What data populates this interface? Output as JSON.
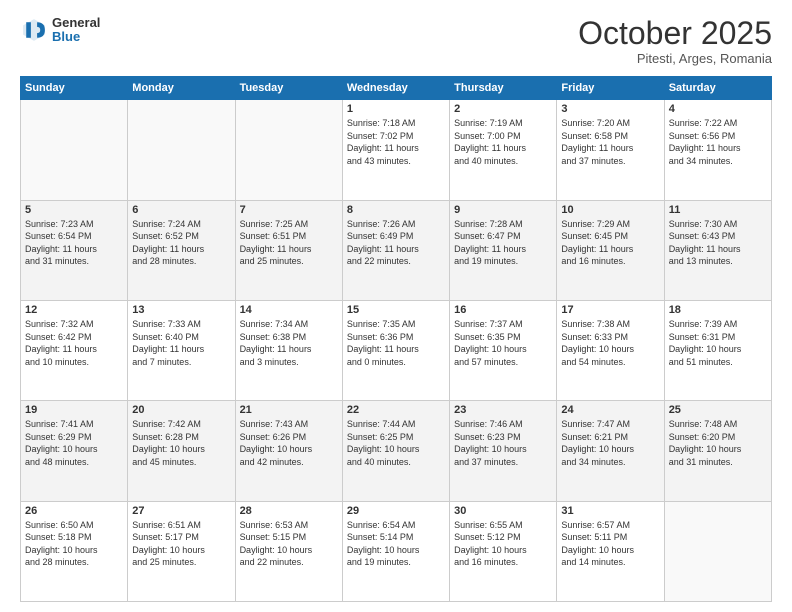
{
  "header": {
    "logo_general": "General",
    "logo_blue": "Blue",
    "month": "October 2025",
    "location": "Pitesti, Arges, Romania"
  },
  "days_of_week": [
    "Sunday",
    "Monday",
    "Tuesday",
    "Wednesday",
    "Thursday",
    "Friday",
    "Saturday"
  ],
  "weeks": [
    [
      {
        "day": "",
        "info": ""
      },
      {
        "day": "",
        "info": ""
      },
      {
        "day": "",
        "info": ""
      },
      {
        "day": "1",
        "info": "Sunrise: 7:18 AM\nSunset: 7:02 PM\nDaylight: 11 hours\nand 43 minutes."
      },
      {
        "day": "2",
        "info": "Sunrise: 7:19 AM\nSunset: 7:00 PM\nDaylight: 11 hours\nand 40 minutes."
      },
      {
        "day": "3",
        "info": "Sunrise: 7:20 AM\nSunset: 6:58 PM\nDaylight: 11 hours\nand 37 minutes."
      },
      {
        "day": "4",
        "info": "Sunrise: 7:22 AM\nSunset: 6:56 PM\nDaylight: 11 hours\nand 34 minutes."
      }
    ],
    [
      {
        "day": "5",
        "info": "Sunrise: 7:23 AM\nSunset: 6:54 PM\nDaylight: 11 hours\nand 31 minutes."
      },
      {
        "day": "6",
        "info": "Sunrise: 7:24 AM\nSunset: 6:52 PM\nDaylight: 11 hours\nand 28 minutes."
      },
      {
        "day": "7",
        "info": "Sunrise: 7:25 AM\nSunset: 6:51 PM\nDaylight: 11 hours\nand 25 minutes."
      },
      {
        "day": "8",
        "info": "Sunrise: 7:26 AM\nSunset: 6:49 PM\nDaylight: 11 hours\nand 22 minutes."
      },
      {
        "day": "9",
        "info": "Sunrise: 7:28 AM\nSunset: 6:47 PM\nDaylight: 11 hours\nand 19 minutes."
      },
      {
        "day": "10",
        "info": "Sunrise: 7:29 AM\nSunset: 6:45 PM\nDaylight: 11 hours\nand 16 minutes."
      },
      {
        "day": "11",
        "info": "Sunrise: 7:30 AM\nSunset: 6:43 PM\nDaylight: 11 hours\nand 13 minutes."
      }
    ],
    [
      {
        "day": "12",
        "info": "Sunrise: 7:32 AM\nSunset: 6:42 PM\nDaylight: 11 hours\nand 10 minutes."
      },
      {
        "day": "13",
        "info": "Sunrise: 7:33 AM\nSunset: 6:40 PM\nDaylight: 11 hours\nand 7 minutes."
      },
      {
        "day": "14",
        "info": "Sunrise: 7:34 AM\nSunset: 6:38 PM\nDaylight: 11 hours\nand 3 minutes."
      },
      {
        "day": "15",
        "info": "Sunrise: 7:35 AM\nSunset: 6:36 PM\nDaylight: 11 hours\nand 0 minutes."
      },
      {
        "day": "16",
        "info": "Sunrise: 7:37 AM\nSunset: 6:35 PM\nDaylight: 10 hours\nand 57 minutes."
      },
      {
        "day": "17",
        "info": "Sunrise: 7:38 AM\nSunset: 6:33 PM\nDaylight: 10 hours\nand 54 minutes."
      },
      {
        "day": "18",
        "info": "Sunrise: 7:39 AM\nSunset: 6:31 PM\nDaylight: 10 hours\nand 51 minutes."
      }
    ],
    [
      {
        "day": "19",
        "info": "Sunrise: 7:41 AM\nSunset: 6:29 PM\nDaylight: 10 hours\nand 48 minutes."
      },
      {
        "day": "20",
        "info": "Sunrise: 7:42 AM\nSunset: 6:28 PM\nDaylight: 10 hours\nand 45 minutes."
      },
      {
        "day": "21",
        "info": "Sunrise: 7:43 AM\nSunset: 6:26 PM\nDaylight: 10 hours\nand 42 minutes."
      },
      {
        "day": "22",
        "info": "Sunrise: 7:44 AM\nSunset: 6:25 PM\nDaylight: 10 hours\nand 40 minutes."
      },
      {
        "day": "23",
        "info": "Sunrise: 7:46 AM\nSunset: 6:23 PM\nDaylight: 10 hours\nand 37 minutes."
      },
      {
        "day": "24",
        "info": "Sunrise: 7:47 AM\nSunset: 6:21 PM\nDaylight: 10 hours\nand 34 minutes."
      },
      {
        "day": "25",
        "info": "Sunrise: 7:48 AM\nSunset: 6:20 PM\nDaylight: 10 hours\nand 31 minutes."
      }
    ],
    [
      {
        "day": "26",
        "info": "Sunrise: 6:50 AM\nSunset: 5:18 PM\nDaylight: 10 hours\nand 28 minutes."
      },
      {
        "day": "27",
        "info": "Sunrise: 6:51 AM\nSunset: 5:17 PM\nDaylight: 10 hours\nand 25 minutes."
      },
      {
        "day": "28",
        "info": "Sunrise: 6:53 AM\nSunset: 5:15 PM\nDaylight: 10 hours\nand 22 minutes."
      },
      {
        "day": "29",
        "info": "Sunrise: 6:54 AM\nSunset: 5:14 PM\nDaylight: 10 hours\nand 19 minutes."
      },
      {
        "day": "30",
        "info": "Sunrise: 6:55 AM\nSunset: 5:12 PM\nDaylight: 10 hours\nand 16 minutes."
      },
      {
        "day": "31",
        "info": "Sunrise: 6:57 AM\nSunset: 5:11 PM\nDaylight: 10 hours\nand 14 minutes."
      },
      {
        "day": "",
        "info": ""
      }
    ]
  ]
}
